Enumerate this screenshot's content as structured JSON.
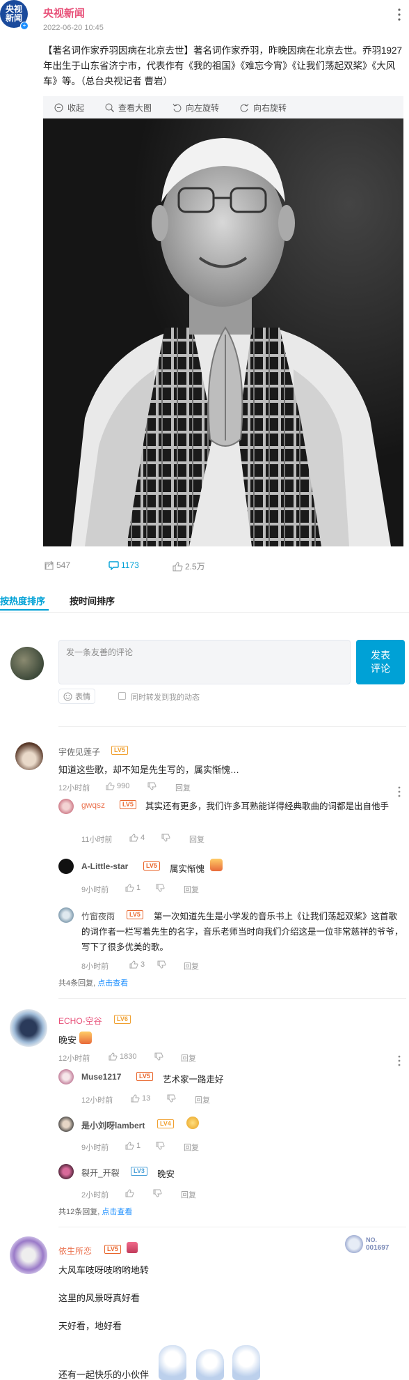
{
  "post": {
    "author": "央视新闻",
    "avatar_text_top": "央视",
    "avatar_text_bottom": "新闻",
    "time": "2022-06-20 10:45",
    "text": "【著名词作家乔羽因病在北京去世】著名词作家乔羽，昨晚因病在北京去世。乔羽1927年出生于山东省济宁市，代表作有《我的祖国》《难忘今宵》《让我们荡起双桨》《大风车》等。（总台央视记者 曹岩）",
    "toolbar": {
      "collapse": "收起",
      "view_large": "查看大图",
      "rotate_left": "向左旋转",
      "rotate_right": "向右旋转"
    },
    "stats": {
      "reposts": "547",
      "comments": "1173",
      "likes": "2.5万"
    }
  },
  "tabs": {
    "hot": "按热度排序",
    "time": "按时间排序"
  },
  "composer": {
    "placeholder": "发一条友善的评论",
    "submit_line1": "发表",
    "submit_line2": "评论",
    "emoji": "表情",
    "sync": "同时转发到我的动态"
  },
  "comments": [
    {
      "user": "宇佐见莲子",
      "level": "LV5",
      "text": "知道这些歌，却不知是先生写的，属实惭愧…",
      "time": "12小时前",
      "likes": "990",
      "reply": "回复",
      "replies": [
        {
          "user": "gwqsz",
          "level": "LV5",
          "text": "其实还有更多，我们许多耳熟能详得经典歌曲的词都是出自他手",
          "time": "11小时前",
          "likes": "4",
          "reply": "回复"
        },
        {
          "user": "A-Little-star",
          "level": "LV5",
          "text": "属实惭愧",
          "time": "9小时前",
          "likes": "1",
          "reply": "回复"
        },
        {
          "user": "竹窗夜雨",
          "level": "LV5",
          "text": "第一次知道先生是小学发的音乐书上《让我们荡起双桨》这首歌的词作者一栏写着先生的名字，音乐老师当时向我们介绍这是一位非常慈祥的爷爷，写下了很多优美的歌。",
          "time": "8小时前",
          "likes": "3",
          "reply": "回复"
        }
      ],
      "more_count": "共4条回复,",
      "more_link": "点击查看"
    },
    {
      "user": "ECHO-空谷",
      "level": "LV6",
      "text": "晚安",
      "time": "12小时前",
      "likes": "1830",
      "reply": "回复",
      "replies": [
        {
          "user": "Muse1217",
          "level": "LV5",
          "text": "艺术家一路走好",
          "time": "12小时前",
          "likes": "13",
          "reply": "回复"
        },
        {
          "user": "是小刘呀lambert",
          "level": "LV4",
          "text": "",
          "time": "9小时前",
          "likes": "1",
          "reply": "回复"
        },
        {
          "user": "裂开_开裂",
          "level": "LV3",
          "text": "晚安",
          "time": "2小时前",
          "likes": "",
          "reply": "回复"
        }
      ],
      "more_count": "共12条回复,",
      "more_link": "点击查看"
    },
    {
      "user": "依生所恋",
      "level": "LV5",
      "lines": [
        "大风车吱呀吱哟哟地转",
        "这里的风景呀真好看",
        "天好看，地好看",
        "还有一起快乐的小伙伴"
      ],
      "badge_label": "NO.",
      "badge_number": "001697"
    }
  ],
  "colors": {
    "accent": "#00a1d6",
    "link": "#1e90ff",
    "name_pink": "#e8527a",
    "name_orange": "#eb7350"
  }
}
